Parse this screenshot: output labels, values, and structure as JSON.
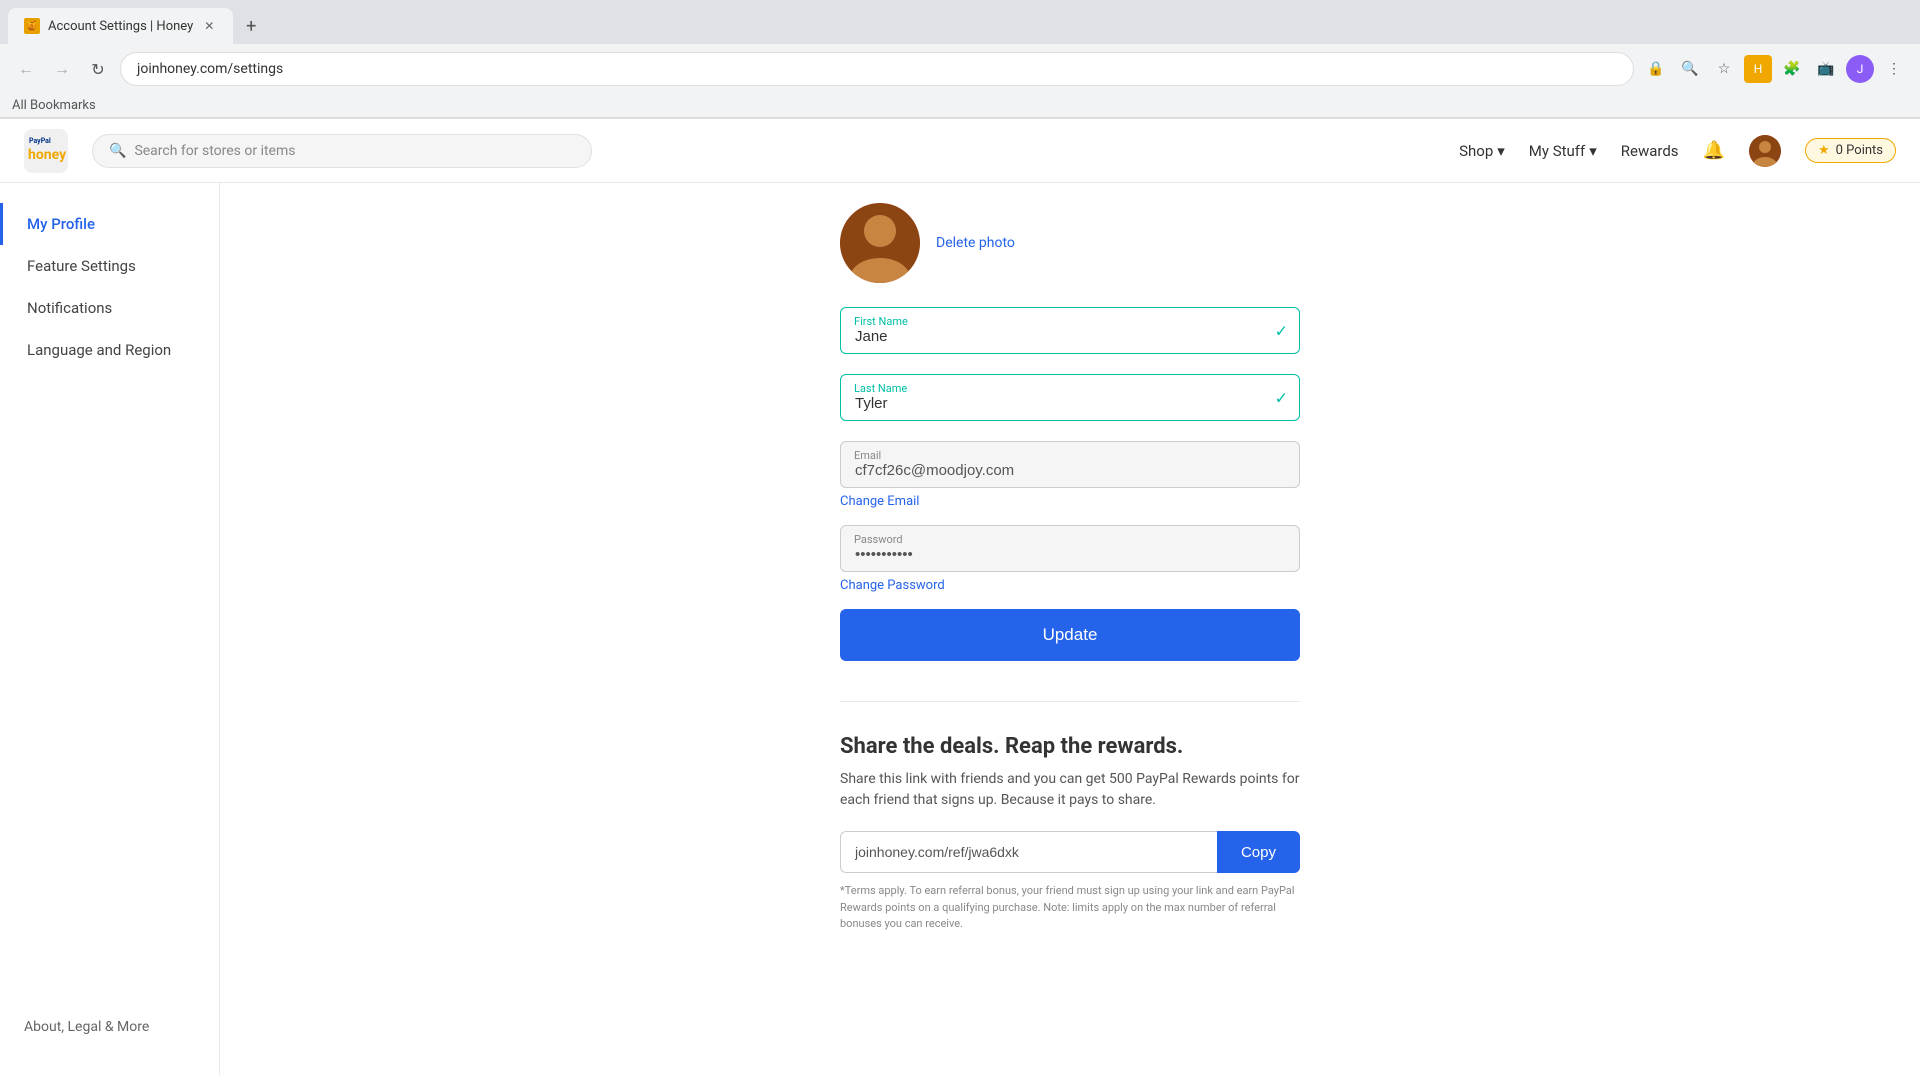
{
  "browser": {
    "tab_title": "Account Settings | Honey",
    "url": "joinhoney.com/settings",
    "new_tab_label": "+",
    "bookmarks_label": "All Bookmarks"
  },
  "topnav": {
    "logo_paypal": "PayPal",
    "logo_honey": "honey",
    "search_placeholder": "Search for stores or items",
    "shop_label": "Shop",
    "mystuff_label": "My Stuff",
    "rewards_label": "Rewards",
    "points_label": "0 Points"
  },
  "sidebar": {
    "items": [
      {
        "id": "my-profile",
        "label": "My Profile",
        "active": true
      },
      {
        "id": "feature-settings",
        "label": "Feature Settings",
        "active": false
      },
      {
        "id": "notifications",
        "label": "Notifications",
        "active": false
      },
      {
        "id": "language-region",
        "label": "Language and Region",
        "active": false
      }
    ],
    "bottom_item": "About, Legal & More"
  },
  "profile": {
    "delete_photo_label": "Delete photo",
    "first_name_label": "First Name",
    "first_name_value": "Jane",
    "last_name_label": "Last Name",
    "last_name_value": "Tyler",
    "email_label": "Email",
    "email_value": "cf7cf26c@moodjoy.com",
    "change_email_label": "Change Email",
    "password_label": "Password",
    "password_value": "••••••••",
    "change_password_label": "Change Password",
    "update_button_label": "Update"
  },
  "referral": {
    "title": "Share the deals. Reap the rewards.",
    "description": "Share this link with friends and you can get 500 PayPal Rewards points for each friend that signs up. Because it pays to share.",
    "referral_link": "joinhoney.com/ref/jwa6dxk",
    "copy_button_label": "Copy",
    "terms": "*Terms apply. To earn referral bonus, your friend must sign up using your link and earn PayPal Rewards points on a qualifying purchase. Note: limits apply on the max number of referral bonuses you can receive."
  }
}
